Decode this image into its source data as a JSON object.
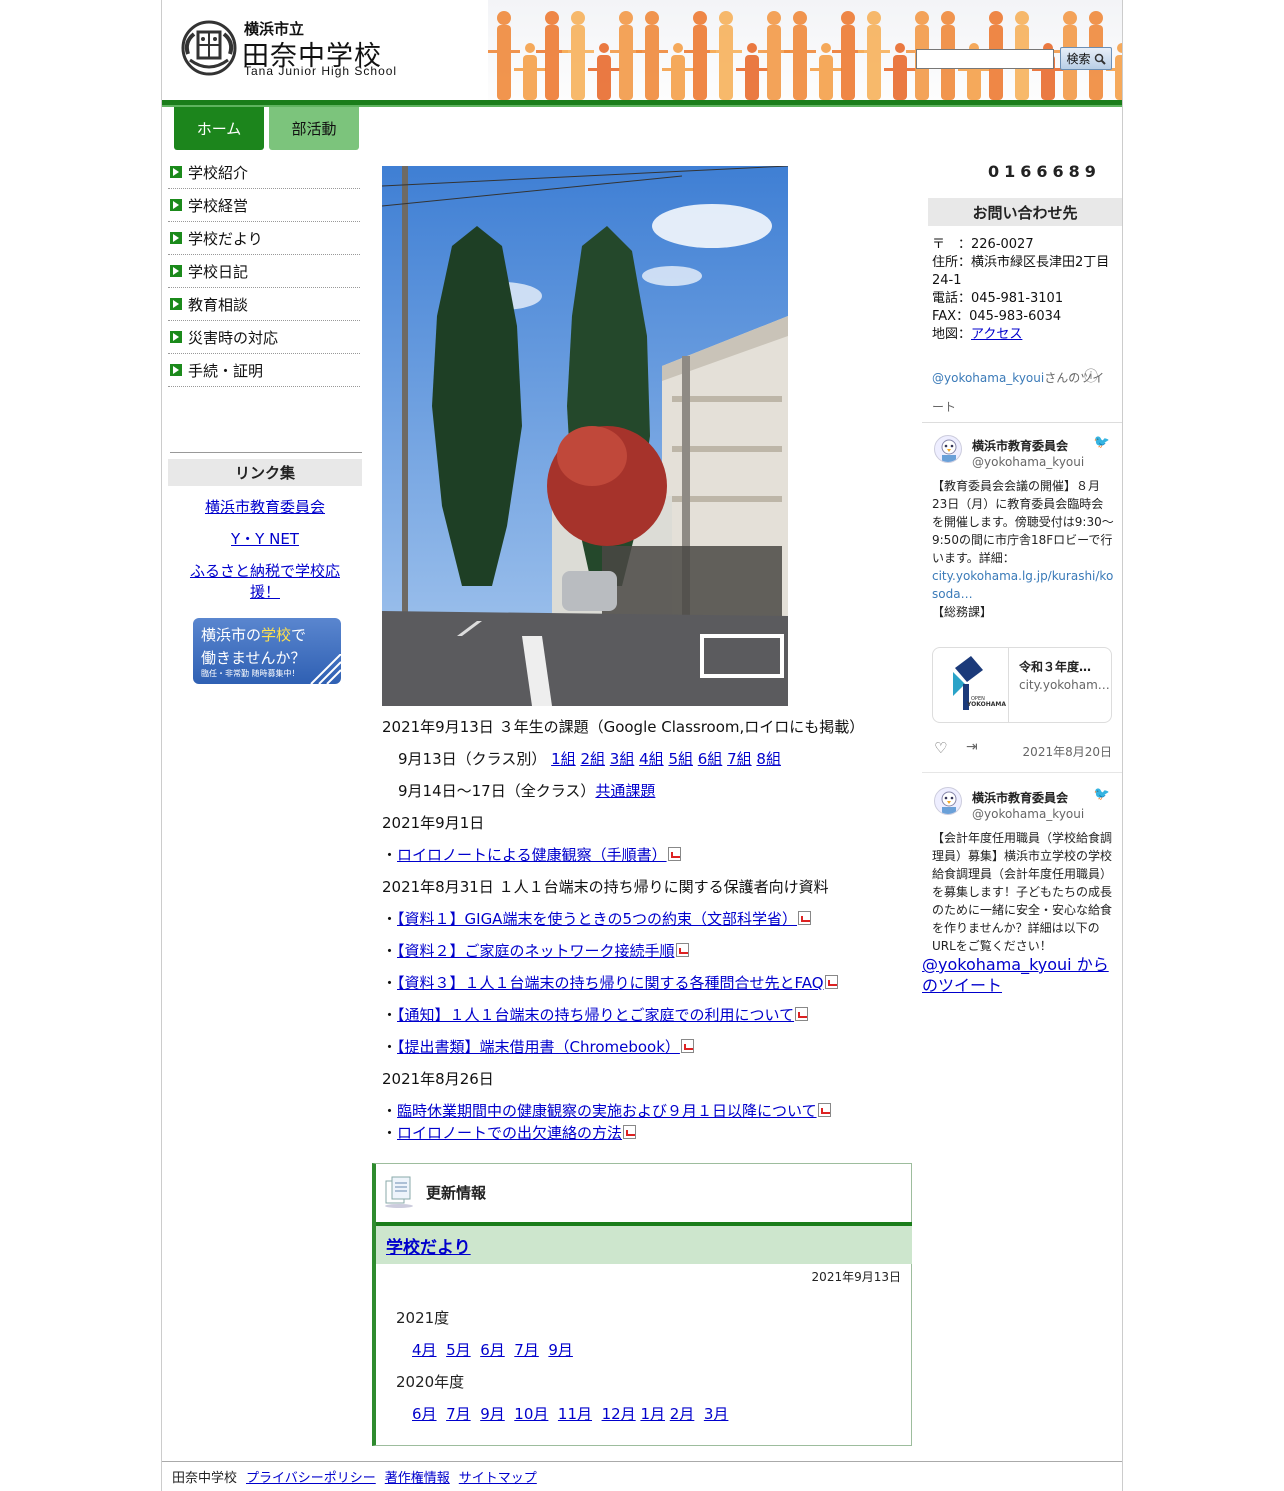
{
  "header": {
    "city": "横浜市立",
    "school_name": "田奈中学校",
    "school_name_en": "Tana Junior High School",
    "search_button": "検索",
    "search_value": ""
  },
  "tabs": [
    "ホーム",
    "部活動"
  ],
  "sidebar": {
    "items": [
      "学校紹介",
      "学校経営",
      "学校だより",
      "学校日記",
      "教育相談",
      "災害時の対応",
      "手続・証明"
    ],
    "links_title": "リンク集",
    "links": [
      "横浜市教育委員会",
      "Y・Y NET",
      "ふるさと納税で学校応援！"
    ],
    "recruit": {
      "line1_a": "横浜市の",
      "line1_b": "学校",
      "line1_c": "で",
      "line2": "働きませんか？",
      "line3": "臨任・非常勤 随時募集中！"
    }
  },
  "main": {
    "l1": "2021年9月13日 ３年生の課題（Google Classroom,ロイロにも掲載）",
    "l2_prefix": "9月13日（クラス別）",
    "class_links": [
      "1組",
      "2組",
      "3組",
      "4組",
      "5組",
      "6組",
      "7組",
      "8組"
    ],
    "l3_prefix": "9月14日～17日（全クラス）",
    "l3_link": "共通課題",
    "l4": "2021年9月1日",
    "l5_link": "ロイロノートによる健康観察（手順書）",
    "l6": "2021年8月31日 １人１台端末の持ち帰りに関する保護者向け資料",
    "l7_link": "【資料１】GIGA端末を使うときの5つの約束（文部科学省）",
    "l8_link": "【資料２】ご家庭のネットワーク接続手順",
    "l9_link": "【資料３】１人１台端末の持ち帰りに関する各種問合せ先とFAQ",
    "l10_link": "【通知】１人１台端末の持ち帰りとご家庭での利用について",
    "l11_link": "【提出書類】端末借用書（Chromebook）",
    "l12": "2021年8月26日",
    "l13_link": "臨時休業期間中の健康観察の実施および９月１日以降について",
    "l14_link": "ロイロノートでの出欠連絡の方法",
    "bullet": "・"
  },
  "update": {
    "title": "更新情報",
    "sub_link": "学校だより",
    "date": "2021年9月13日",
    "year1": "2021度",
    "months1": [
      "4月",
      "5月",
      "6月",
      "7月",
      "9月"
    ],
    "year2": "2020年度",
    "months2": [
      "6月",
      "7月",
      "9月",
      "10月",
      "11月",
      "12月",
      "1月",
      "2月",
      "3月"
    ]
  },
  "right": {
    "counter": "0166689",
    "contact_title": "お問い合わせ先",
    "postal": "〒　：226-0027",
    "address1": "住所：横浜市緑区長津田2丁目",
    "address2": "24-1",
    "tel": "電話：045-981-3101",
    "fax": "FAX：045-983-6034",
    "map_label": "地図：",
    "map_link": "アクセス",
    "tw_handle": "@yokohama_kyoui",
    "tw_suffix": "さんのツイート",
    "tweet1": {
      "name": "横浜市教育委員会",
      "handle": "@yokohama_kyoui",
      "text": "【教育委員会会議の開催】８月23日（月）に教育委員会臨時会を開催します。傍聴受付は9:30～9:50の間に市庁舎18Fロビーで行います。詳細：",
      "link": "city.yokohama.lg.jp/kurashi/kosoda…",
      "tail": "【総務課】",
      "card_title": "令和３年度…",
      "card_domain": "city.yokoham…",
      "card_logo_small": "OPEN",
      "card_logo": "YOKOHAMA",
      "date": "2021年8月20日"
    },
    "tweet2": {
      "name": "横浜市教育委員会",
      "handle": "@yokohama_kyoui",
      "text": "【会計年度任用職員（学校給食調理員）募集】横浜市立学校の学校給食調理員（会計年度任用職員）を募集します！子どもたちの成長のために一緒に安全・安心な給食を作りませんか？詳細は以下のURLをご覧ください！"
    },
    "tw_footer": "@yokohama_kyoui からのツイート"
  },
  "footer": {
    "name": "田奈中学校",
    "links": [
      "プライバシーポリシー",
      "著作権情報",
      "サイトマップ"
    ]
  },
  "colors": {
    "green": "#1c851c",
    "light_green": "#7cc47c",
    "link": "#0000cc"
  }
}
